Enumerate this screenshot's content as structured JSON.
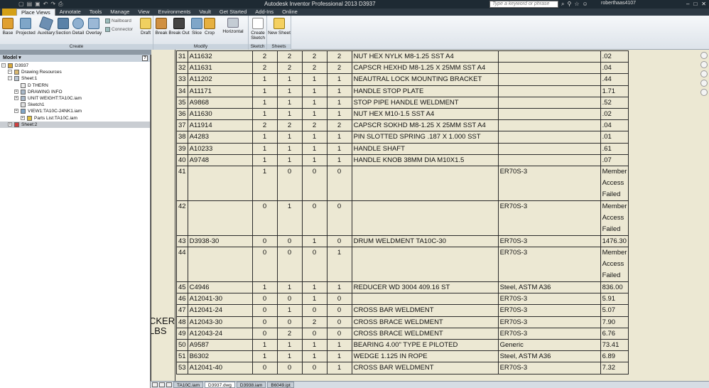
{
  "titlebar": {
    "title": "Autodesk Inventor Professional 2013    D3937",
    "search_placeholder": "Type a keyword or phrase",
    "user": "roberthaas4107"
  },
  "tabs": [
    "Place Views",
    "Annotate",
    "Tools",
    "Manage",
    "View",
    "Environments",
    "Vault",
    "Get Started",
    "Add-Ins",
    "Online"
  ],
  "ribbon": {
    "create": {
      "label": "Create",
      "buttons": [
        "Base",
        "Projected",
        "Auxiliary",
        "Section",
        "Detail",
        "Overlay"
      ],
      "small": [
        "Nailboard",
        "Connector"
      ]
    },
    "modify": {
      "label": "Modify",
      "buttons": [
        "Draft",
        "Break",
        "Break Out",
        "Slice",
        "Crop"
      ],
      "horizontal": "Horizontal"
    },
    "sketch": {
      "label": "Sketch",
      "button": "Create Sketch"
    },
    "sheets": {
      "label": "Sheets",
      "button": "New Sheet"
    }
  },
  "browser": {
    "title": "Model",
    "nodes": [
      {
        "label": "D3937",
        "indent": 0
      },
      {
        "label": "Drawing Resources",
        "indent": 1
      },
      {
        "label": "Sheet:1",
        "indent": 1
      },
      {
        "label": "D THERN",
        "indent": 2
      },
      {
        "label": "DRAWING INFO",
        "indent": 2
      },
      {
        "label": "UNIT WEIGHT:TA10C.iam",
        "indent": 2
      },
      {
        "label": "Sketch1",
        "indent": 2
      },
      {
        "label": "VIEW1:TA10C-24NK1.iam",
        "indent": 2
      },
      {
        "label": "Parts List:TA10C.iam",
        "indent": 3
      },
      {
        "label": "Sheet:2",
        "indent": 1
      }
    ]
  },
  "drawing": {
    "side_text": [
      "CKER",
      "LBS"
    ],
    "rows": [
      {
        "item": "31",
        "part": "A11632",
        "q1": "2",
        "q2": "2",
        "q3": "2",
        "q4": "2",
        "desc": "NUT HEX NYLK M8-1.25 SST A4",
        "mat": "",
        "wt": ".02",
        "tall": false
      },
      {
        "item": "32",
        "part": "A11631",
        "q1": "2",
        "q2": "2",
        "q3": "2",
        "q4": "2",
        "desc": "CAPSCR HEXHD M8-1.25 X 25MM SST A4",
        "mat": "",
        "wt": ".04",
        "tall": false
      },
      {
        "item": "33",
        "part": "A11202",
        "q1": "1",
        "q2": "1",
        "q3": "1",
        "q4": "1",
        "desc": "NEAUTRAL LOCK MOUNTING BRACKET",
        "mat": "",
        "wt": ".44",
        "tall": false
      },
      {
        "item": "34",
        "part": "A11171",
        "q1": "1",
        "q2": "1",
        "q3": "1",
        "q4": "1",
        "desc": "HANDLE STOP PLATE",
        "mat": "",
        "wt": "1.71",
        "tall": false
      },
      {
        "item": "35",
        "part": "A9868",
        "q1": "1",
        "q2": "1",
        "q3": "1",
        "q4": "1",
        "desc": "STOP PIPE HANDLE WELDMENT",
        "mat": "",
        "wt": ".52",
        "tall": false
      },
      {
        "item": "36",
        "part": "A11630",
        "q1": "1",
        "q2": "1",
        "q3": "1",
        "q4": "1",
        "desc": "NUT HEX M10-1.5 SST A4",
        "mat": "",
        "wt": ".02",
        "tall": false
      },
      {
        "item": "37",
        "part": "A11914",
        "q1": "2",
        "q2": "2",
        "q3": "2",
        "q4": "2",
        "desc": "CAPSCR SOKHD M8-1.25 X 25MM SST A4",
        "mat": "",
        "wt": ".04",
        "tall": false
      },
      {
        "item": "38",
        "part": "A4283",
        "q1": "1",
        "q2": "1",
        "q3": "1",
        "q4": "1",
        "desc": "PIN SLOTTED SPRING .187 X 1.000 SST",
        "mat": "",
        "wt": ".01",
        "tall": false
      },
      {
        "item": "39",
        "part": "A10233",
        "q1": "1",
        "q2": "1",
        "q3": "1",
        "q4": "1",
        "desc": "HANDLE SHAFT",
        "mat": "",
        "wt": ".61",
        "tall": false
      },
      {
        "item": "40",
        "part": "A9748",
        "q1": "1",
        "q2": "1",
        "q3": "1",
        "q4": "1",
        "desc": "HANDLE KNOB 38MM DIA M10X1.5",
        "mat": "",
        "wt": ".07",
        "tall": false
      },
      {
        "item": "41",
        "part": "",
        "q1": "1",
        "q2": "0",
        "q3": "0",
        "q4": "0",
        "desc": "",
        "mat": "ER70S-3",
        "wt": "Member Access Failed",
        "tall": true
      },
      {
        "item": "42",
        "part": "",
        "q1": "0",
        "q2": "1",
        "q3": "0",
        "q4": "0",
        "desc": "",
        "mat": "ER70S-3",
        "wt": "Member Access Failed",
        "tall": true
      },
      {
        "item": "43",
        "part": "D3938-30",
        "q1": "0",
        "q2": "0",
        "q3": "1",
        "q4": "0",
        "desc": "DRUM WELDMENT TA10C-30",
        "mat": "ER70S-3",
        "wt": "1476.30",
        "tall": false
      },
      {
        "item": "44",
        "part": "",
        "q1": "0",
        "q2": "0",
        "q3": "0",
        "q4": "1",
        "desc": "",
        "mat": "ER70S-3",
        "wt": "Member Access Failed",
        "tall": true
      },
      {
        "item": "45",
        "part": "C4946",
        "q1": "1",
        "q2": "1",
        "q3": "1",
        "q4": "1",
        "desc": "REDUCER WD 3004 409.16 ST",
        "mat": "Steel, ASTM A36",
        "wt": "836.00",
        "tall": false
      },
      {
        "item": "46",
        "part": "A12041-30",
        "q1": "0",
        "q2": "0",
        "q3": "1",
        "q4": "0",
        "desc": "",
        "mat": "ER70S-3",
        "wt": "5.91",
        "tall": false
      },
      {
        "item": "47",
        "part": "A12041-24",
        "q1": "0",
        "q2": "1",
        "q3": "0",
        "q4": "0",
        "desc": "CROSS BAR WELDMENT",
        "mat": "ER70S-3",
        "wt": "5.07",
        "tall": false
      },
      {
        "item": "48",
        "part": "A12043-30",
        "q1": "0",
        "q2": "0",
        "q3": "2",
        "q4": "0",
        "desc": "CROSS BRACE WELDMENT",
        "mat": "ER70S-3",
        "wt": "7.90",
        "tall": false
      },
      {
        "item": "49",
        "part": "A12043-24",
        "q1": "0",
        "q2": "2",
        "q3": "0",
        "q4": "0",
        "desc": "CROSS BRACE WELDMENT",
        "mat": "ER70S-3",
        "wt": "6.76",
        "tall": false
      },
      {
        "item": "50",
        "part": "A9587",
        "q1": "1",
        "q2": "1",
        "q3": "1",
        "q4": "1",
        "desc": "BEARING 4.00\" TYPE E PILOTED",
        "mat": "Generic",
        "wt": "73.41",
        "tall": false
      },
      {
        "item": "51",
        "part": "B6302",
        "q1": "1",
        "q2": "1",
        "q3": "1",
        "q4": "1",
        "desc": "WEDGE 1.125 IN ROPE",
        "mat": "Steel, ASTM A36",
        "wt": "6.89",
        "tall": false
      },
      {
        "item": "53",
        "part": "A12041-40",
        "q1": "0",
        "q2": "0",
        "q3": "0",
        "q4": "1",
        "desc": "CROSS BAR WELDMENT",
        "mat": "ER70S-3",
        "wt": "7.32",
        "tall": false
      }
    ]
  },
  "doc_tabs": [
    {
      "label": "TA10C.iam",
      "active": false
    },
    {
      "label": "D3937.dwg",
      "active": true
    },
    {
      "label": "D3938.iam",
      "active": false
    },
    {
      "label": "B6049.ipt",
      "active": false
    }
  ],
  "colors": {
    "sheet": "#ece8d3",
    "ribbon_active_tab": "#eef2f6",
    "app_button": "#d4a017"
  }
}
